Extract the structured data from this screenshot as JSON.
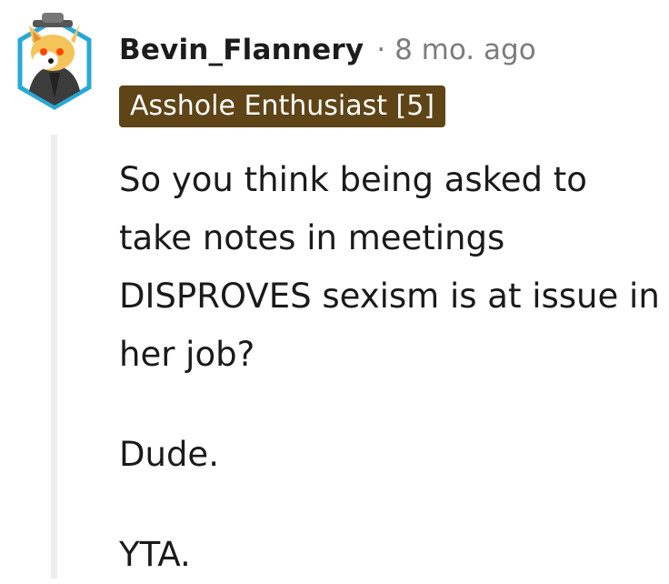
{
  "comment": {
    "username": "Bevin_Flannery",
    "separator": "·",
    "timestamp": "8 mo. ago",
    "flair": "Asshole Enthusiast [5]",
    "paragraphs": [
      "So you think being asked to take notes in meetings DISPROVES sexism is at issue in her job?",
      "Dude.",
      "YTA."
    ]
  },
  "avatar": {
    "icon": "snoo-doge-avatar-icon",
    "colors": {
      "frame": "#2aa8d4",
      "face": "#f4c45a",
      "hoodie": "#3c3c3c"
    }
  },
  "colors": {
    "flair_background": "#5e4417",
    "flair_text": "#ffffff",
    "meta_text": "#7c7c7c",
    "thread_line": "#ededed"
  }
}
